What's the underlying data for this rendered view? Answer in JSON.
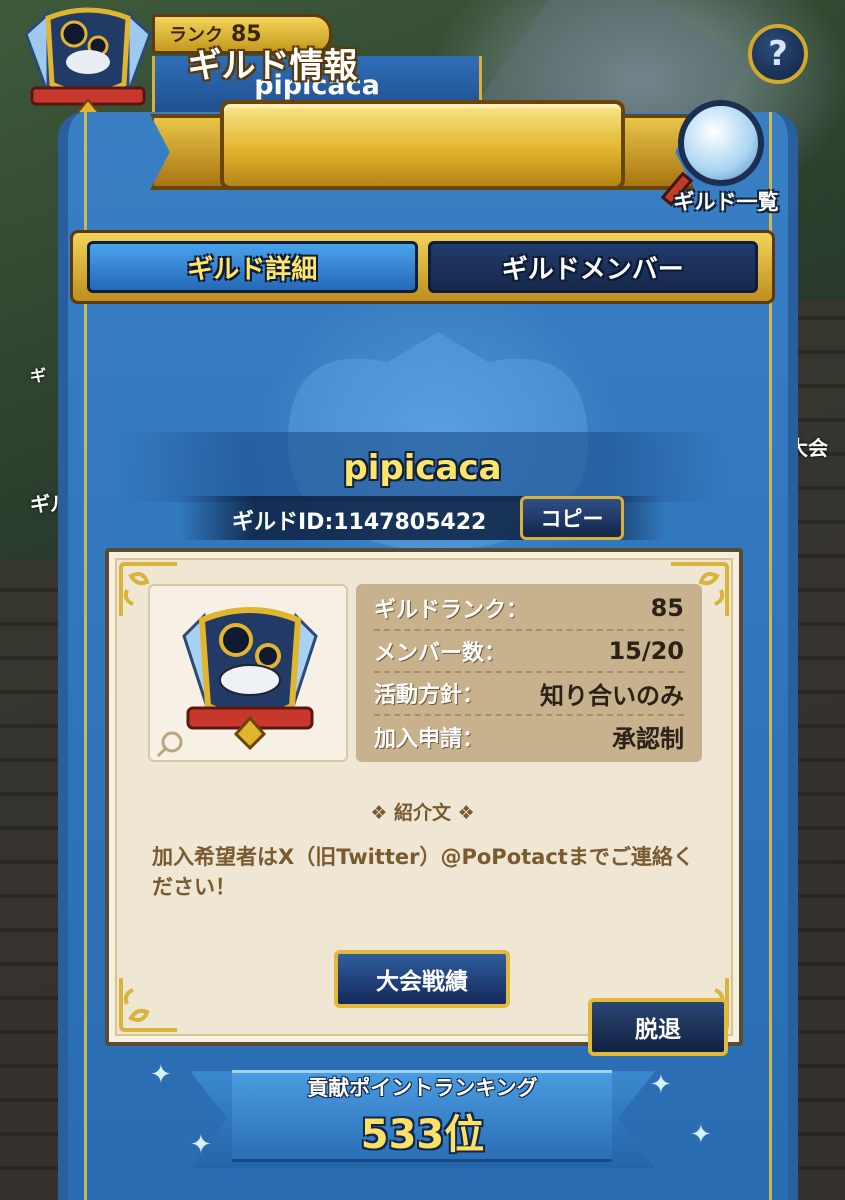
{
  "header": {
    "rank_label": "ランク",
    "rank_value": "85",
    "guild_name": "pipicaca"
  },
  "panel": {
    "title": "ギルド情報",
    "guild_list_label": "ギルド一覧"
  },
  "tabs": [
    {
      "label": "ギルド詳細",
      "active": true
    },
    {
      "label": "ギルドメンバー",
      "active": false
    }
  ],
  "guild": {
    "name": "pipicaca",
    "id_text": "ギルドID:1147805422",
    "copy_label": "コピー"
  },
  "stats": [
    {
      "key": "ギルドランク：",
      "value": "85"
    },
    {
      "key": "メンバー数：",
      "value": "15/20"
    },
    {
      "key": "活動方針：",
      "value": "知り合いのみ"
    },
    {
      "key": "加入申請：",
      "value": "承認制"
    }
  ],
  "intro": {
    "heading": "紹介文",
    "text": "加入希望者はX（旧Twitter）@PoPotactまでご連絡ください！"
  },
  "buttons": {
    "tournament": "大会戦績",
    "leave": "脱退"
  },
  "ranking": {
    "title": "貢献ポイントランキング",
    "value": "533位"
  },
  "background_labels": [
    "大会",
    "ギル",
    "ギ"
  ],
  "colors": {
    "panel_blue": "#2f76bd",
    "gold": "#e2b52e",
    "accent_yellow": "#ffe66b",
    "card_bg": "#efe7d3",
    "stats_bg": "#c8b28d",
    "brown_text": "#7a5a30"
  }
}
